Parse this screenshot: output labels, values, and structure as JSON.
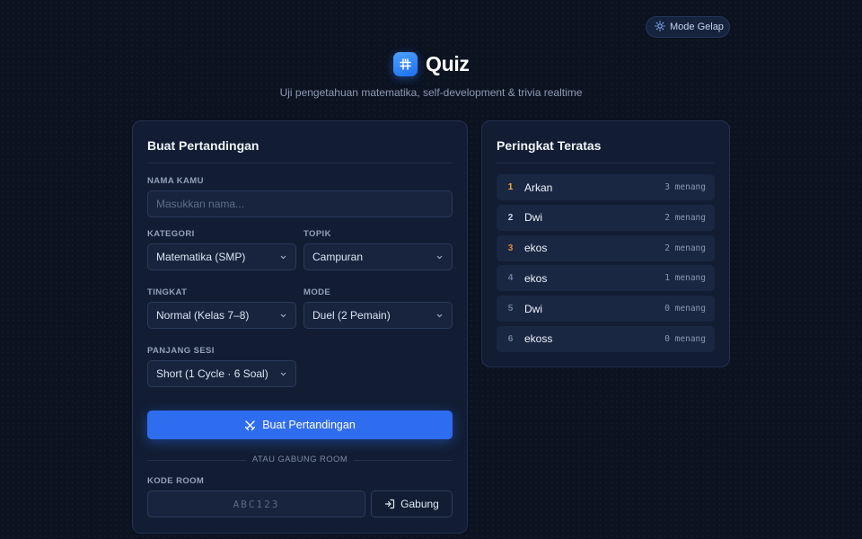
{
  "header": {
    "theme_toggle_label": "Mode Gelap",
    "title": "Quiz",
    "subtitle": "Uji pengetahuan matematika, self-development & trivia realtime"
  },
  "create_card": {
    "title": "Buat Pertandingan",
    "name_label": "NAMA KAMU",
    "name_placeholder": "Masukkan nama...",
    "category_label": "KATEGORI",
    "category_value": "Matematika (SMP)",
    "topic_label": "TOPIK",
    "topic_value": "Campuran",
    "level_label": "TINGKAT",
    "level_value": "Normal (Kelas 7–8)",
    "mode_label": "MODE",
    "mode_value": "Duel (2 Pemain)",
    "session_label": "PANJANG SESI",
    "session_value": "Short (1 Cycle · 6 Soal)",
    "create_button": "Buat Pertandingan",
    "or_join_text": "ATAU GABUNG ROOM",
    "room_code_label": "KODE ROOM",
    "room_code_placeholder": "ABC123",
    "join_button": "Gabung"
  },
  "leaderboard": {
    "title": "Peringkat Teratas",
    "rows": [
      {
        "rank": "1",
        "name": "Arkan",
        "wins": "3 menang",
        "rank_color": "#f2b23a"
      },
      {
        "rank": "2",
        "name": "Dwi",
        "wins": "2 menang",
        "rank_color": "#cfd8e6"
      },
      {
        "rank": "3",
        "name": "ekos",
        "wins": "2 menang",
        "rank_color": "#e08a3c"
      },
      {
        "rank": "4",
        "name": "ekos",
        "wins": "1 menang",
        "rank_color": "#6f7d97"
      },
      {
        "rank": "5",
        "name": "Dwi",
        "wins": "0 menang",
        "rank_color": "#6f7d97"
      },
      {
        "rank": "6",
        "name": "ekoss",
        "wins": "0 menang",
        "rank_color": "#6f7d97"
      }
    ]
  },
  "colors": {
    "background": "#0b1220",
    "card": "#121d33",
    "accent": "#2f6df0"
  },
  "icons": {
    "theme_toggle": "sun-icon",
    "logo": "hash-grid-icon",
    "create_button": "swords-icon",
    "join_button": "login-icon",
    "select": "chevron-down-icon"
  }
}
